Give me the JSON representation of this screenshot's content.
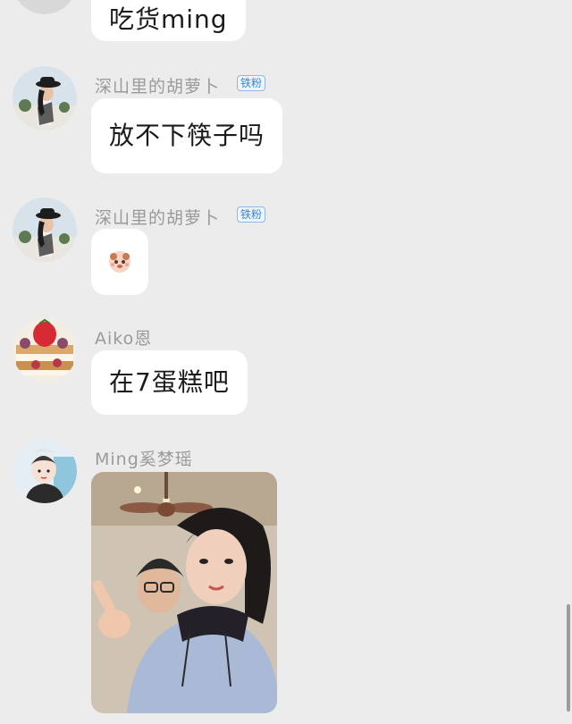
{
  "messages": [
    {
      "sender": "",
      "text": "吃货ming"
    },
    {
      "sender": "深山里的胡萝卜",
      "badge": "铁粉",
      "text": "放不下筷子吗",
      "avatar_icon": "girl-hat-avatar"
    },
    {
      "sender": "深山里的胡萝卜",
      "badge": "铁粉",
      "sticker_icon": "cute-face-emoji",
      "avatar_icon": "girl-hat-avatar"
    },
    {
      "sender": "Aiko恩",
      "text": "在7蛋糕吧",
      "avatar_icon": "strawberry-cake-avatar"
    },
    {
      "sender": "Ming奚梦瑶",
      "photo_icon": "selfie-photo",
      "avatar_icon": "cartoon-girl-avatar"
    }
  ],
  "colors": {
    "background": "#ececec",
    "bubble": "#ffffff",
    "sender_name": "#9a9a9a",
    "badge": "#3b86d4"
  }
}
